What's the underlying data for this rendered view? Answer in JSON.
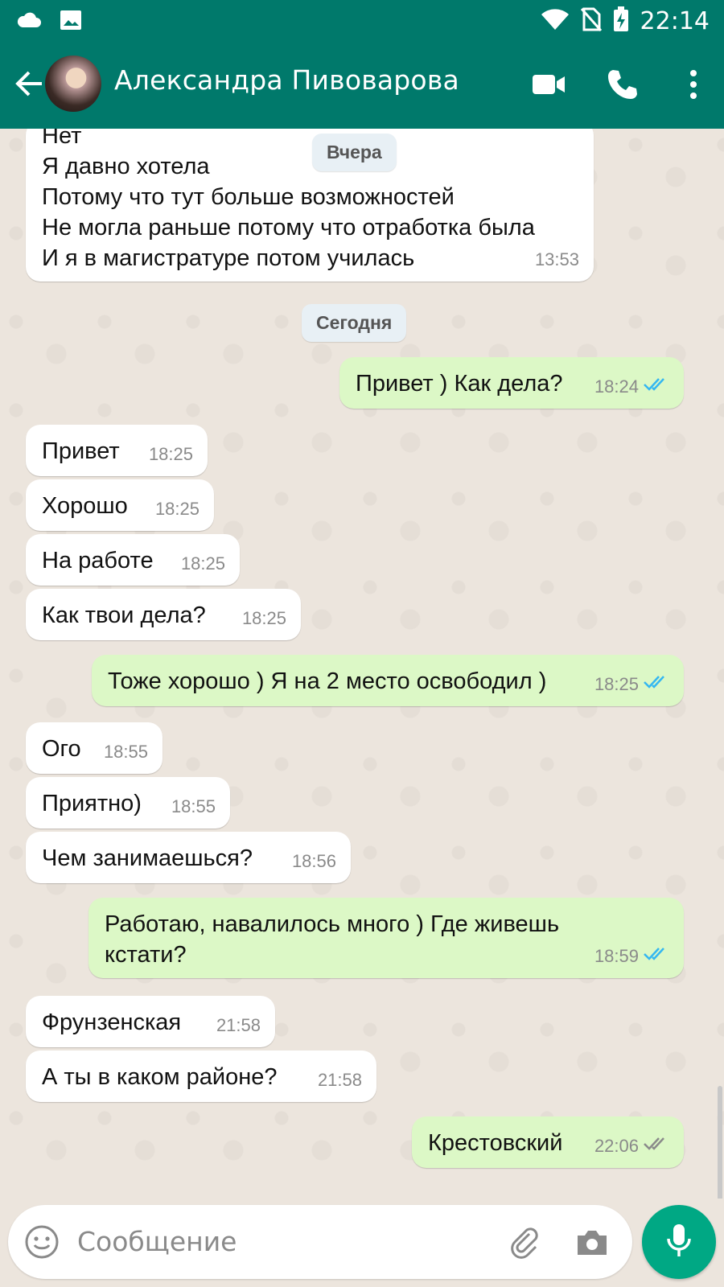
{
  "status": {
    "time": "22:14"
  },
  "header": {
    "contact_name": "Александра Пивоварова"
  },
  "dates": {
    "yesterday": "Вчера",
    "today": "Сегодня"
  },
  "messages": [
    {
      "dir": "in",
      "text": "Нет\nЯ давно хотела\nПотому что тут больше возможностей\nНе могла раньше потому что отработка была\nИ я в магистратуре потом училась",
      "time": "13:53"
    },
    {
      "dir": "out",
      "text": "Привет ) Как дела?",
      "time": "18:24",
      "status": "read"
    },
    {
      "dir": "in",
      "text": "Привет",
      "time": "18:25"
    },
    {
      "dir": "in",
      "text": "Хорошо",
      "time": "18:25"
    },
    {
      "dir": "in",
      "text": "На работе",
      "time": "18:25"
    },
    {
      "dir": "in",
      "text": "Как твои дела?",
      "time": "18:25"
    },
    {
      "dir": "out",
      "text": "Тоже хорошо ) Я на 2 место освободил )",
      "time": "18:25",
      "status": "read"
    },
    {
      "dir": "in",
      "text": "Ого",
      "time": "18:55"
    },
    {
      "dir": "in",
      "text": "Приятно)",
      "time": "18:55"
    },
    {
      "dir": "in",
      "text": "Чем занимаешься?",
      "time": "18:56"
    },
    {
      "dir": "out",
      "text": "Работаю, навалилось много ) Где живешь\nкстати?",
      "time": "18:59",
      "status": "read"
    },
    {
      "dir": "in",
      "text": "Фрунзенская",
      "time": "21:58"
    },
    {
      "dir": "in",
      "text": "А ты в каком районе?",
      "time": "21:58"
    },
    {
      "dir": "out",
      "text": "Крестовский",
      "time": "22:06",
      "status": "delivered"
    }
  ],
  "input": {
    "placeholder": "Сообщение"
  },
  "colors": {
    "header": "#00796b",
    "outgoing": "#dcf8c6",
    "read_ticks": "#34b7f1",
    "mic": "#00a884"
  }
}
